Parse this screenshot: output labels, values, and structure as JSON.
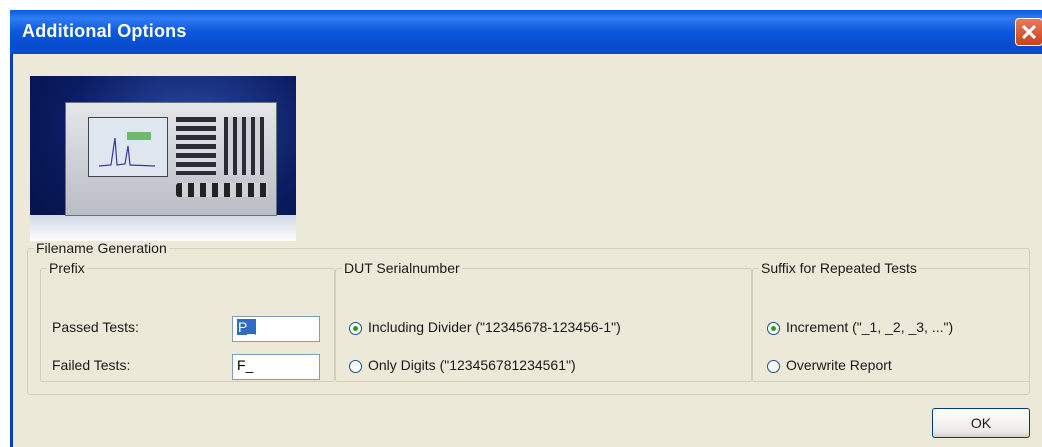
{
  "window": {
    "title": "Additional Options"
  },
  "filename_generation": {
    "legend": "Filename Generation",
    "prefix": {
      "legend": "Prefix",
      "passed_label": "Passed Tests:",
      "passed_value": "P_",
      "failed_label": "Failed Tests:",
      "failed_value": "F_"
    },
    "dut_serial": {
      "legend": "DUT Serialnumber",
      "options": [
        {
          "label": "Including Divider (\"12345678-123456-1\")",
          "selected": true
        },
        {
          "label": "Only Digits (\"123456781234561\")",
          "selected": false
        }
      ]
    },
    "suffix": {
      "legend": "Suffix for Repeated Tests",
      "options": [
        {
          "label": "Increment (\"_1, _2, _3, ...\")",
          "selected": true
        },
        {
          "label": "Overwrite Report",
          "selected": false
        }
      ]
    }
  },
  "buttons": {
    "ok": "OK"
  },
  "colors": {
    "titlebar": "#0a5ae6",
    "dialog_bg": "#ece9d8",
    "selection": "#316ac5"
  }
}
